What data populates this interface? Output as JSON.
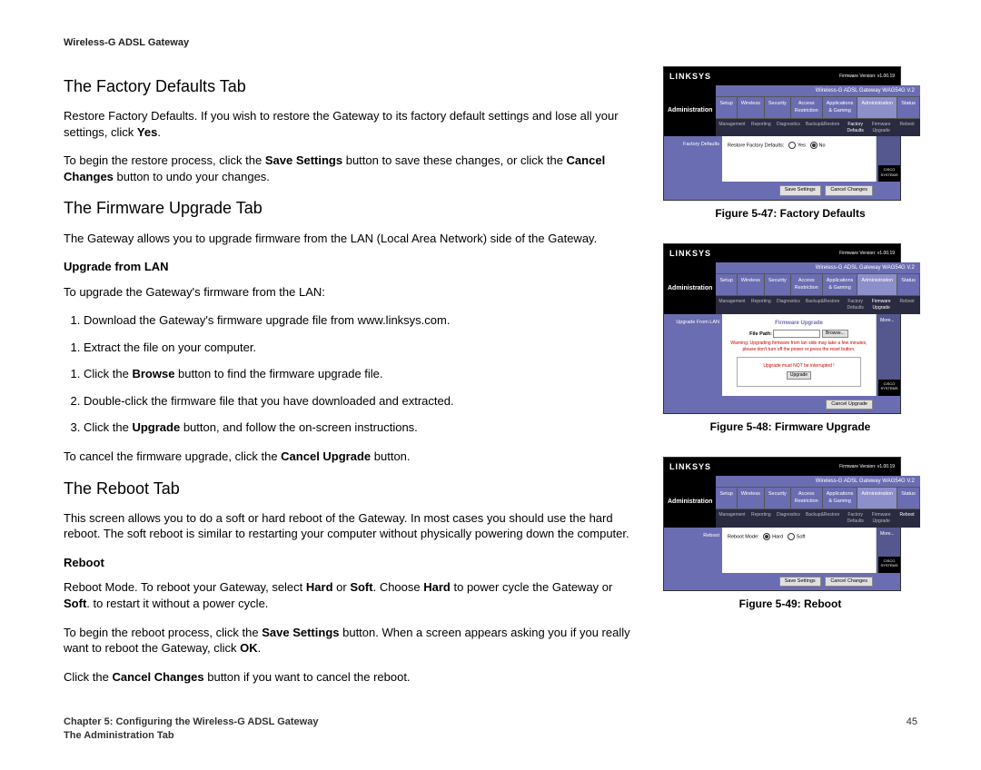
{
  "header": {
    "product": "Wireless-G ADSL Gateway"
  },
  "main": {
    "h_factory": "The Factory Defaults Tab",
    "p_factory1_a": "Restore Factory Defaults. If you wish to restore the Gateway to its factory default settings and lose all your settings, click ",
    "p_factory1_b": "Yes",
    "p_factory1_c": ".",
    "p_factory2_a": "To begin the restore process, click the ",
    "p_factory2_b": "Save Settings",
    "p_factory2_c": " button to save these changes, or click the ",
    "p_factory2_d": "Cancel Changes",
    "p_factory2_e": " button to undo your changes.",
    "h_firmware": "The Firmware Upgrade Tab",
    "p_firmware1": "The Gateway allows you to upgrade firmware from the LAN (Local Area Network) side of the Gateway.",
    "h_upgrade_lan": "Upgrade from LAN",
    "p_upgrade_intro": "To upgrade the Gateway's firmware from the LAN:",
    "steps": {
      "s1": "Download the Gateway's firmware upgrade file from www.linksys.com.",
      "s2": "Extract the file on your computer.",
      "s3_a": "Click the ",
      "s3_b": "Browse",
      "s3_c": " button to find the firmware upgrade file.",
      "s4": "Double-click the firmware file that you have downloaded and extracted.",
      "s5_a": "Click the ",
      "s5_b": "Upgrade",
      "s5_c": " button, and follow the on-screen instructions."
    },
    "p_cancel_fw_a": "To cancel the firmware upgrade, click the ",
    "p_cancel_fw_b": "Cancel Upgrade",
    "p_cancel_fw_c": " button.",
    "h_reboot": "The Reboot Tab",
    "p_reboot1": "This screen allows you to do a soft or hard reboot of the Gateway. In most cases you should use the hard reboot. The soft reboot is similar to restarting your computer without physically powering down the computer.",
    "h_reboot_sub": "Reboot",
    "p_reboot2_a": "Reboot Mode. To reboot your Gateway, select ",
    "p_reboot2_b": "Hard",
    "p_reboot2_c": " or ",
    "p_reboot2_d": "Soft",
    "p_reboot2_e": ". Choose ",
    "p_reboot2_f": "Hard",
    "p_reboot2_g": " to power cycle the Gateway or ",
    "p_reboot2_h": "Soft",
    "p_reboot2_i": ". to restart it without a power cycle.",
    "p_reboot3_a": "To begin the reboot process, click the ",
    "p_reboot3_b": "Save Settings",
    "p_reboot3_c": " button. When a screen appears asking you if you really want to reboot the Gateway, click ",
    "p_reboot3_d": "OK",
    "p_reboot3_e": ".",
    "p_reboot4_a": "Click the ",
    "p_reboot4_b": "Cancel Changes",
    "p_reboot4_c": " button if you want to cancel the reboot."
  },
  "figures": {
    "logo": "LINKSYS",
    "model_line": "Wireless-G ADSL Gateway   WAG54G V.2",
    "admin": "Administration",
    "tabs": [
      "Setup",
      "Wireless",
      "Security",
      "Access Restriction",
      "Applications & Gaming",
      "Administration",
      "Status"
    ],
    "fig47": {
      "caption": "Figure 5-47: Factory Defaults",
      "subtabs": [
        "Management",
        "Reporting",
        "Diagnostics",
        "Backup&Restore",
        "Factory Defaults",
        "Firmware Upgrade",
        "Reboot"
      ],
      "left_label": "Factory Defaults",
      "row_label": "Restore Factory Defaults:",
      "yes": "Yes",
      "no": "No",
      "save": "Save Settings",
      "cancel": "Cancel Changes"
    },
    "fig48": {
      "caption": "Figure 5-48: Firmware Upgrade",
      "left_label": "Upgrade From LAN",
      "title": "Firmware Upgrade",
      "file_path": "File Path:",
      "browse": "Browse...",
      "warning": "Warning: Upgrading firmware from lan side may take a few minutes, please don't turn off the power or press the reset button.",
      "box_text": "Upgrade must NOT be interrupted !",
      "upgrade": "Upgrade",
      "cancel": "Cancel Upgrade",
      "more": "More..."
    },
    "fig49": {
      "caption": "Figure 5-49: Reboot",
      "left_label": "Reboot",
      "row_label": "Reboot Mode:",
      "hard": "Hard",
      "soft": "Soft",
      "save": "Save Settings",
      "cancel": "Cancel Changes",
      "more": "More..."
    },
    "cisco": "CISCO SYSTEMS"
  },
  "footer": {
    "chapter": "Chapter 5: Configuring the Wireless-G ADSL Gateway",
    "section": "The Administration Tab",
    "page": "45"
  }
}
